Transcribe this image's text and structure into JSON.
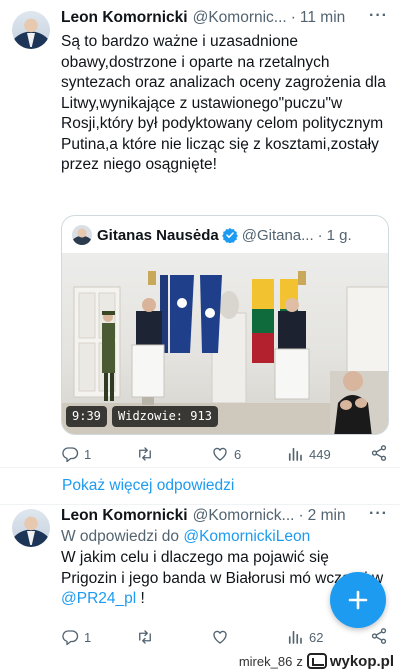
{
  "tweet1": {
    "name": "Leon Komornicki",
    "handle": "@Komornic...",
    "dot": "·",
    "time": "11 min",
    "more": "···",
    "text": "Są to bardzo ważne i uzasadnione obawy,dostrzone i oparte na rzetalnych syntezach oraz analizach oceny zagrożenia dla Litwy,wynikające z ustawionego\"puczu\"w Rosji,który był podyktowany celom politycznym Putina,a które nie licząc się z kosztami,zostały przez niego osągnięte!",
    "quote": {
      "name": "Gitanas Nausėda",
      "handle": "@Gitana...",
      "dot": "·",
      "time": "1 g.",
      "video_time": "9:39",
      "video_views": "Widzowie: 913"
    },
    "stats": {
      "replies": "1",
      "retweets": "",
      "likes": "6",
      "views": "449"
    }
  },
  "show_more": "Pokaż więcej odpowiedzi",
  "tweet2": {
    "name": "Leon Komornicki",
    "handle": "@Komornick...",
    "dot": "·",
    "time": "2 min",
    "more": "···",
    "reply_prefix": "W odpowiedzi do ",
    "reply_to": "@KomornickiLeon",
    "text_part1": "W jakim celu i dlaczego ma pojawić się Prigozin i jego banda w Białorusi mó",
    "text_part2": "wczoraj w ",
    "mention": "@PR24_pl",
    "text_part3": " !",
    "stats": {
      "replies": "1",
      "retweets": "",
      "likes": "",
      "views": "62"
    }
  },
  "watermark": {
    "user": "mirek_86",
    "z": "z",
    "site": "wykop.pl"
  },
  "colors": {
    "accent": "#1d9bf0",
    "muted": "#536471",
    "text": "#0f1419"
  }
}
